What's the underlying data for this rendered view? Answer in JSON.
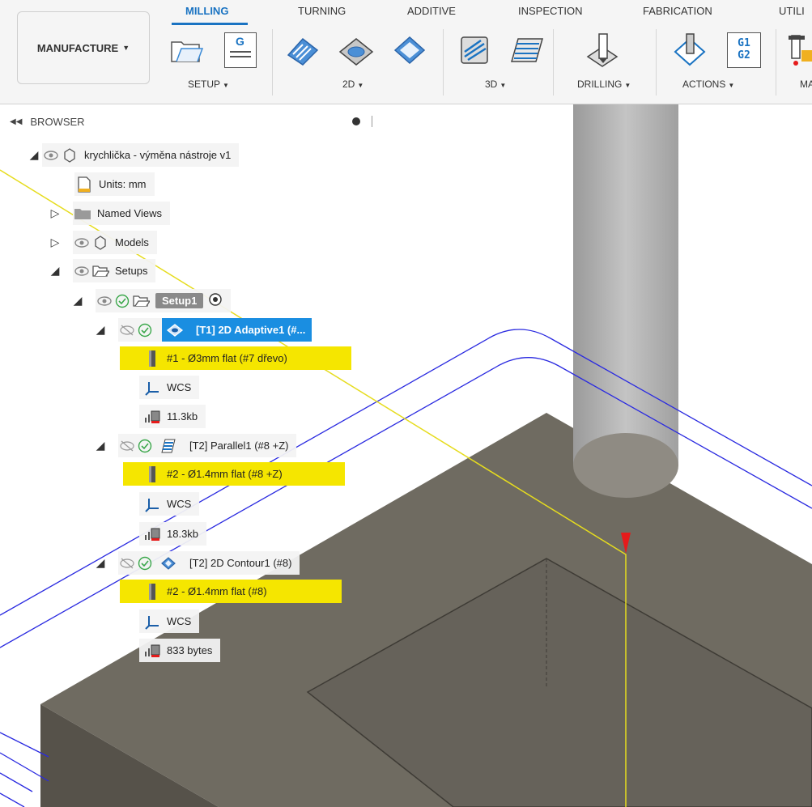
{
  "workspace": {
    "label": "MANUFACTURE"
  },
  "tabs": [
    {
      "label": "MILLING",
      "active": true
    },
    {
      "label": "TURNING"
    },
    {
      "label": "ADDITIVE"
    },
    {
      "label": "INSPECTION"
    },
    {
      "label": "FABRICATION"
    },
    {
      "label": "UTILI"
    }
  ],
  "groups": {
    "setup": "SETUP",
    "twod": "2D",
    "threed": "3D",
    "drilling": "DRILLING",
    "actions": "ACTIONS",
    "manage": "MA"
  },
  "ribbon_icons": {
    "nc_program_text": "G",
    "post_text_1": "G1",
    "post_text_2": "G2"
  },
  "browser": {
    "title": "BROWSER",
    "root": {
      "label": "krychlička - výměna nástroje v1"
    },
    "units": {
      "label": "Units: mm"
    },
    "named_views": {
      "label": "Named Views"
    },
    "models": {
      "label": "Models"
    },
    "setups": {
      "label": "Setups"
    },
    "setup1": {
      "label": "Setup1"
    },
    "operations": [
      {
        "label": "[T1] 2D Adaptive1 (#...",
        "tool": "#1 - Ø3mm flat (#7 dřevo)",
        "wcs": "WCS",
        "size": "11.3kb"
      },
      {
        "label": "[T2] Parallel1 (#8 +Z)",
        "tool": "#2 - Ø1.4mm flat (#8 +Z)",
        "wcs": "WCS",
        "size": "18.3kb"
      },
      {
        "label": "[T2] 2D Contour1 (#8)",
        "tool": "#2 - Ø1.4mm flat (#8)",
        "wcs": "WCS",
        "size": "833 bytes"
      }
    ]
  },
  "colors": {
    "accent": "#1a73c2",
    "selection": "#1a8ee1",
    "highlight": "#f5e600",
    "toolpath": "#2a2ae0",
    "stock": "#6e6a60",
    "tool": "#b5b5b5"
  }
}
